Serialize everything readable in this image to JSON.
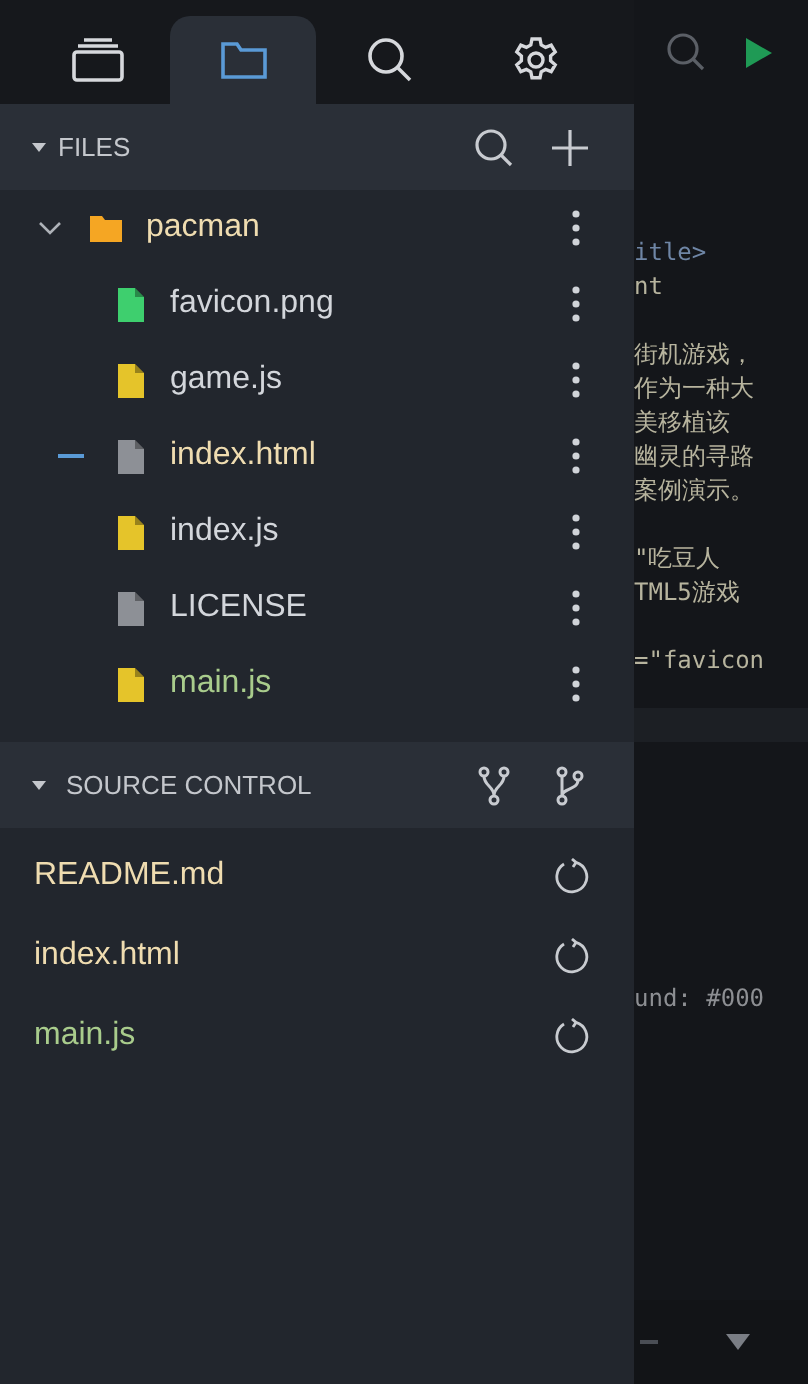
{
  "tabs": [
    {
      "kind": "windows",
      "selected": false
    },
    {
      "kind": "files",
      "selected": true
    },
    {
      "kind": "search",
      "selected": false
    },
    {
      "kind": "settings",
      "selected": false
    }
  ],
  "files": {
    "title": "FILES",
    "expanded": true,
    "tree": [
      {
        "name": "pacman",
        "kind": "folder",
        "expanded": true,
        "modified": true,
        "added": false,
        "children": [
          {
            "name": "favicon.png",
            "kind": "image",
            "modified": false,
            "added": false,
            "active": false
          },
          {
            "name": "game.js",
            "kind": "script",
            "modified": false,
            "added": false,
            "active": false
          },
          {
            "name": "index.html",
            "kind": "plain",
            "modified": true,
            "added": false,
            "active": true
          },
          {
            "name": "index.js",
            "kind": "script",
            "modified": false,
            "added": false,
            "active": false
          },
          {
            "name": "LICENSE",
            "kind": "plain",
            "modified": false,
            "added": false,
            "active": false
          },
          {
            "name": "main.js",
            "kind": "script",
            "modified": false,
            "added": true,
            "active": false
          }
        ]
      }
    ]
  },
  "source_control": {
    "title": "SOURCE CONTROL",
    "expanded": true,
    "changes": [
      {
        "name": "README.md",
        "modified": true,
        "added": false
      },
      {
        "name": "index.html",
        "modified": true,
        "added": false
      },
      {
        "name": "main.js",
        "modified": false,
        "added": true
      }
    ]
  },
  "editor": {
    "blocks": [
      [
        "itle>",
        "nt"
      ],
      [
        "街机游戏，",
        "作为一种大",
        "美移植该",
        "幽灵的寻路",
        "案例演示。"
      ],
      [
        "\"吃豆人",
        "TML5游戏"
      ],
      [
        "=\"favicon"
      ]
    ],
    "lower_lines": [
      "und: #000"
    ]
  }
}
